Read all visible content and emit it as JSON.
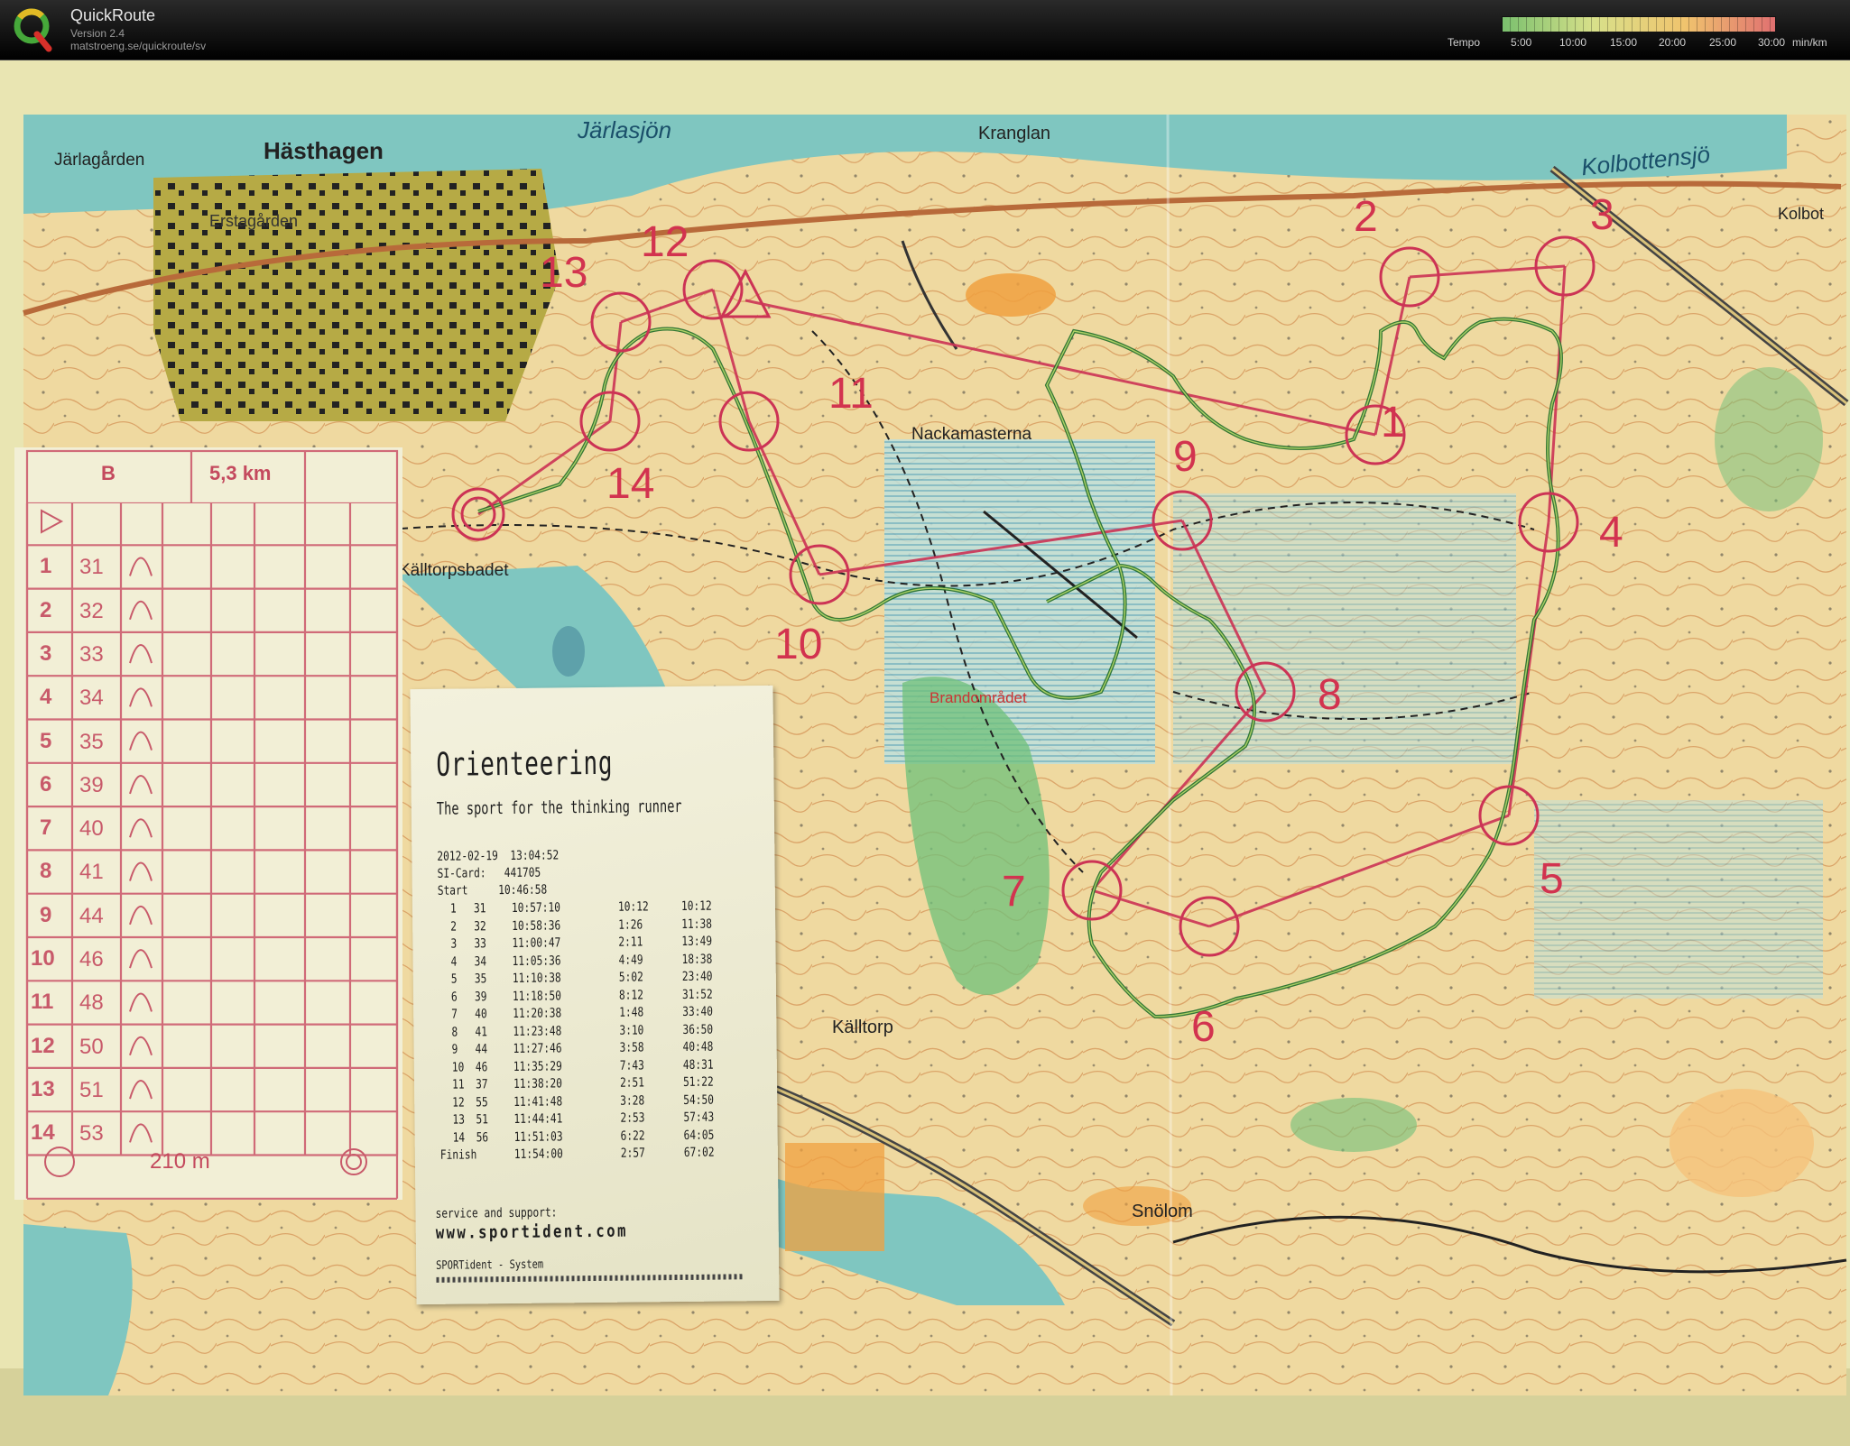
{
  "app": {
    "title": "QuickRoute",
    "version": "Version 2.4",
    "url": "matstroeng.se/quickroute/sv"
  },
  "tempo_legend": {
    "label": "Tempo",
    "ticks": [
      "5:00",
      "10:00",
      "15:00",
      "20:00",
      "25:00",
      "30:00"
    ],
    "unit": "min/km",
    "colors": [
      "#7ac06e",
      "#d8e08a",
      "#f0c46e",
      "#e07070"
    ]
  },
  "map": {
    "place_names": [
      "Järlagården",
      "Hästhagen",
      "Järlasjön",
      "Kranglan",
      "Kolbottensjö",
      "Kolbot",
      "Erstagården",
      "Nackamasterna",
      "Källtorpsbadet",
      "Brandområdet",
      "Källtorp",
      "Snölom"
    ],
    "controls": [
      {
        "label": "1"
      },
      {
        "label": "2"
      },
      {
        "label": "3"
      },
      {
        "label": "4"
      },
      {
        "label": "5"
      },
      {
        "label": "6"
      },
      {
        "label": "7"
      },
      {
        "label": "8"
      },
      {
        "label": "9"
      },
      {
        "label": "10"
      },
      {
        "label": "11"
      },
      {
        "label": "12"
      },
      {
        "label": "13"
      },
      {
        "label": "14"
      }
    ],
    "colors": {
      "course": "#cc3355",
      "route": "#1f6b2a",
      "water": "#7fc6c0",
      "open": "#f4e2a8"
    }
  },
  "control_description": {
    "course": "B",
    "length": "5,3 km",
    "rows": [
      {
        "num": "1",
        "code": "31"
      },
      {
        "num": "2",
        "code": "32"
      },
      {
        "num": "3",
        "code": "33"
      },
      {
        "num": "4",
        "code": "34"
      },
      {
        "num": "5",
        "code": "35"
      },
      {
        "num": "6",
        "code": "39"
      },
      {
        "num": "7",
        "code": "40"
      },
      {
        "num": "8",
        "code": "41"
      },
      {
        "num": "9",
        "code": "44"
      },
      {
        "num": "10",
        "code": "46"
      },
      {
        "num": "11",
        "code": "48"
      },
      {
        "num": "12",
        "code": "50"
      },
      {
        "num": "13",
        "code": "51"
      },
      {
        "num": "14",
        "code": "53"
      }
    ],
    "finish_distance": "210 m"
  },
  "receipt": {
    "title": "Orienteering",
    "subtitle": "The sport for the thinking runner",
    "date_line": "2012-02-19  13:04:52",
    "card_line": "SI-Card:   441705",
    "start_line": "Start     10:46:58",
    "splits": [
      {
        "n": "1",
        "code": "31",
        "time": "10:57:10",
        "leg": "10:12",
        "total": "10:12"
      },
      {
        "n": "2",
        "code": "32",
        "time": "10:58:36",
        "leg": "1:26",
        "total": "11:38"
      },
      {
        "n": "3",
        "code": "33",
        "time": "11:00:47",
        "leg": "2:11",
        "total": "13:49"
      },
      {
        "n": "4",
        "code": "34",
        "time": "11:05:36",
        "leg": "4:49",
        "total": "18:38"
      },
      {
        "n": "5",
        "code": "35",
        "time": "11:10:38",
        "leg": "5:02",
        "total": "23:40"
      },
      {
        "n": "6",
        "code": "39",
        "time": "11:18:50",
        "leg": "8:12",
        "total": "31:52"
      },
      {
        "n": "7",
        "code": "40",
        "time": "11:20:38",
        "leg": "1:48",
        "total": "33:40"
      },
      {
        "n": "8",
        "code": "41",
        "time": "11:23:48",
        "leg": "3:10",
        "total": "36:50"
      },
      {
        "n": "9",
        "code": "44",
        "time": "11:27:46",
        "leg": "3:58",
        "total": "40:48"
      },
      {
        "n": "10",
        "code": "46",
        "time": "11:35:29",
        "leg": "7:43",
        "total": "48:31"
      },
      {
        "n": "11",
        "code": "37",
        "time": "11:38:20",
        "leg": "2:51",
        "total": "51:22"
      },
      {
        "n": "12",
        "code": "55",
        "time": "11:41:48",
        "leg": "3:28",
        "total": "54:50"
      },
      {
        "n": "13",
        "code": "51",
        "time": "11:44:41",
        "leg": "2:53",
        "total": "57:43"
      },
      {
        "n": "14",
        "code": "56",
        "time": "11:51:03",
        "leg": "6:22",
        "total": "64:05"
      }
    ],
    "finish": {
      "label": "Finish",
      "time": "11:54:00",
      "leg": "2:57",
      "total": "67:02"
    },
    "service": "service and support:",
    "website": "www.sportident.com",
    "system": "SPORTident - System"
  }
}
